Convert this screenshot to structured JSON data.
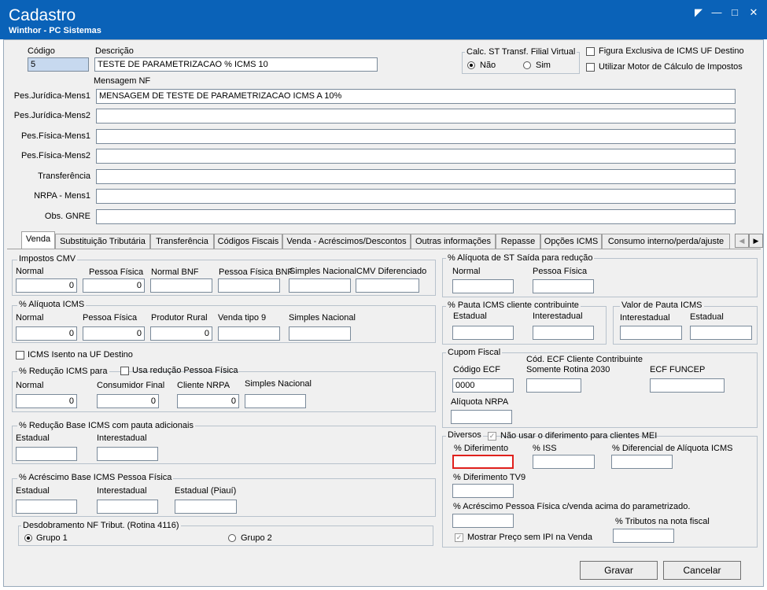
{
  "window": {
    "title": "Cadastro",
    "subtitle": "Winthor - PC Sistemas"
  },
  "header": {
    "codigo_label": "Código",
    "codigo_value": "5",
    "descricao_label": "Descrição",
    "descricao_value": "TESTE DE PARAMETRIZACAO % ICMS 10",
    "calc_st_title": "Calc. ST Transf. Filial Virtual",
    "calc_nao": "Não",
    "calc_sim": "Sim",
    "figura_label": "Figura Exclusiva de ICMS UF Destino",
    "motor_label": "Utilizar Motor de Cálculo de Impostos",
    "mensagem_label": "Mensagem NF"
  },
  "messages": [
    {
      "label": "Pes.Jurídica-Mens1",
      "value": "MENSAGEM DE TESTE DE PARAMETRIZACAO ICMS A 10%"
    },
    {
      "label": "Pes.Jurídica-Mens2",
      "value": ""
    },
    {
      "label": "Pes.Física-Mens1",
      "value": ""
    },
    {
      "label": "Pes.Física-Mens2",
      "value": ""
    },
    {
      "label": "Transferência",
      "value": ""
    },
    {
      "label": "NRPA - Mens1",
      "value": ""
    },
    {
      "label": "Obs. GNRE",
      "value": ""
    }
  ],
  "tabs": [
    "Venda",
    "Substituição Tributária",
    "Transferência",
    "Códigos Fiscais",
    "Venda - Acréscimos/Descontos",
    "Outras informações",
    "Repasse",
    "Opções ICMS",
    "Consumo interno/perda/ajuste"
  ],
  "impostos_cmv": {
    "title": "Impostos CMV",
    "labels": [
      "Normal",
      "Pessoa Física",
      "Normal BNF",
      "Pessoa Física BNF",
      "Simples Nacional",
      "CMV Diferenciado"
    ],
    "values": [
      "0",
      "0",
      "",
      "",
      "",
      ""
    ]
  },
  "aliquota_icms": {
    "title": "% Alíquota ICMS",
    "labels": [
      "Normal",
      "Pessoa Física",
      "Produtor Rural",
      "Venda tipo 9",
      "Simples Nacional"
    ],
    "values": [
      "0",
      "0",
      "0",
      "",
      ""
    ]
  },
  "icms_isento": "ICMS Isento na UF Destino",
  "reducao_icms": {
    "title": "% Redução ICMS para",
    "usa_label": "Usa redução Pessoa Física",
    "labels": [
      "Normal",
      "Consumidor Final",
      "Cliente NRPA",
      "Simples Nacional"
    ],
    "values": [
      "0",
      "0",
      "0",
      ""
    ]
  },
  "reducao_base": {
    "title": "% Redução Base ICMS com pauta adicionais",
    "labels": [
      "Estadual",
      "Interestadual"
    ]
  },
  "acrescimo_base": {
    "title": "% Acréscimo Base ICMS Pessoa Física",
    "labels": [
      "Estadual",
      "Interestadual",
      "Estadual (Piauí)"
    ]
  },
  "desdobramento": {
    "title": "Desdobramento NF Tribut. (Rotina 4116)",
    "opt1": "Grupo 1",
    "opt2": "Grupo 2"
  },
  "aliquota_st": {
    "title": "% Alíquota de ST Saída para redução",
    "labels": [
      "Normal",
      "Pessoa Física"
    ]
  },
  "pauta_icms": {
    "title": "% Pauta ICMS cliente contribuinte",
    "labels": [
      "Estadual",
      "Interestadual"
    ]
  },
  "valor_pauta": {
    "title": "Valor de Pauta ICMS",
    "labels": [
      "Interestadual",
      "Estadual"
    ]
  },
  "cupom": {
    "title": "Cupom Fiscal",
    "codigo_label": "Código ECF",
    "codigo_value": "0000",
    "cod_cliente_label1": "Cód. ECF Cliente Contribuinte",
    "cod_cliente_label2": "Somente Rotina 2030",
    "funcep_label": "ECF FUNCEP",
    "aliquota_nrpa": "Alíquota NRPA"
  },
  "diversos": {
    "title": "Diversos",
    "nao_usar": "Não usar o diferimento para clientes MEI",
    "diferimento": "% Diferimento",
    "iss": "% ISS",
    "diferencial": "% Diferencial de Alíquota ICMS",
    "diferimento_tv9": "% Diferimento TV9",
    "acrescimo_pf": "% Acréscimo Pessoa Física c/venda acima do parametrizado.",
    "tributos": "% Tributos na nota fiscal",
    "mostrar": "Mostrar Preço sem IPI na Venda"
  },
  "buttons": {
    "gravar": "Gravar",
    "cancelar": "Cancelar"
  }
}
